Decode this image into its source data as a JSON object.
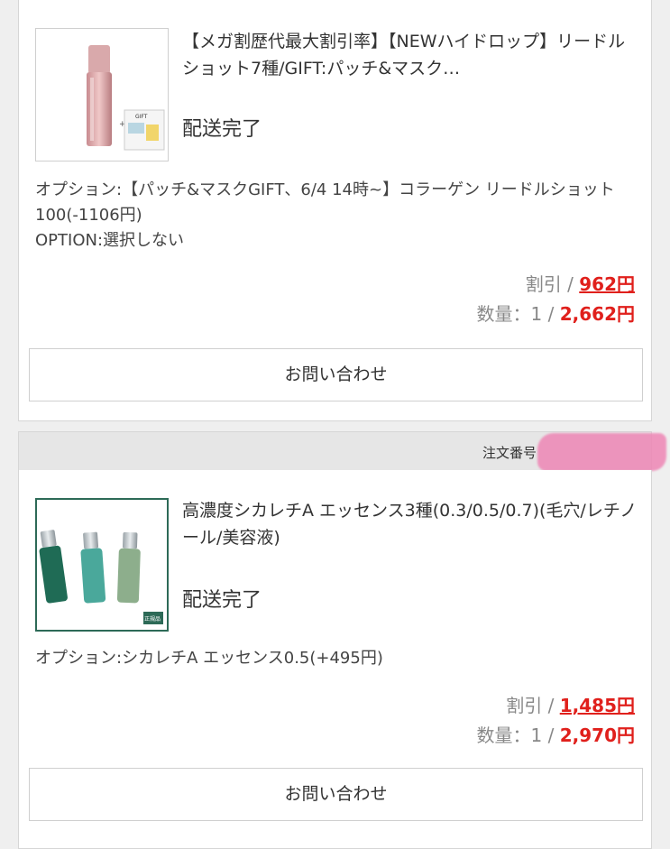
{
  "orders": [
    {
      "product_title": "【メガ割歴代最大割引率】【NEWハイドロップ】リードルショット7種/GIFT:パッチ&マスク…",
      "status": "配送完了",
      "option_lines": [
        "オプション:【パッチ&マスクGIFT、6/4 14時~】コラーゲン リードルショット100(-1106円)",
        "OPTION:選択しない"
      ],
      "discount_label": "割引 / ",
      "discount_value": "962円",
      "quantity_label": "数量：1 / ",
      "price_value": "2,662円",
      "inquiry_button": "お問い合わせ",
      "thumb_gift_text": "GIFT"
    },
    {
      "order_number_label": "注文番号",
      "product_title": "高濃度シカレチA エッセンス3種(0.3/0.5/0.7)(毛穴/レチノール/美容液)",
      "status": "配送完了",
      "option_lines": [
        "オプション:シカレチA エッセンス0.5(+495円)"
      ],
      "discount_label": "割引 / ",
      "discount_value": "1,485円",
      "quantity_label": "数量：1 / ",
      "price_value": "2,970円",
      "inquiry_button": "お問い合わせ",
      "thumb_badge": "正規品"
    }
  ],
  "colors": {
    "accent_red": "#e0201c",
    "redaction_pink": "#ee86b5",
    "thumb_border_green": "#2d6a57"
  }
}
